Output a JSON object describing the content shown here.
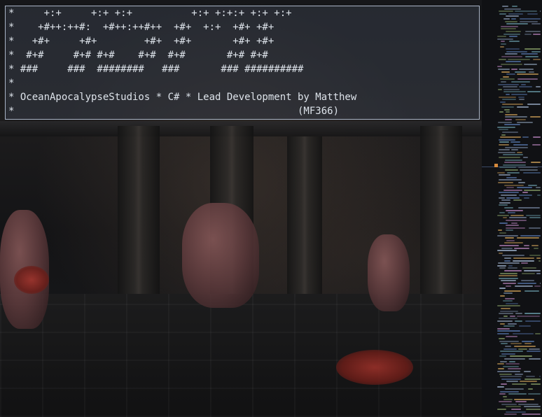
{
  "banner": {
    "lines": [
      "*     +:+     +:+ +:+          +:+ +:+:+ +:+ +:+",
      "*    +#++:++#:  +#++:++#++  +#+  +:+  +#+ +#+",
      "*   +#+     +#+        +#+  +#+       +#+ +#+",
      "*  #+#     #+# #+#    #+#  #+#       #+# #+#",
      "* ###     ###  ########   ###       ### ##########",
      "*",
      "* OceanApocalypseStudios * C# * Lead Development by Matthew",
      "*                                                (MF366)"
    ]
  },
  "game": {
    "scene": "dark-arena-with-monsters"
  },
  "side_panel": {
    "accent_color": "#d68a3c",
    "divider_color": "#3b4a66"
  },
  "colors": {
    "banner_bg": "#343a46",
    "banner_border": "#a9b4c6",
    "banner_text": "#dde3ea"
  }
}
